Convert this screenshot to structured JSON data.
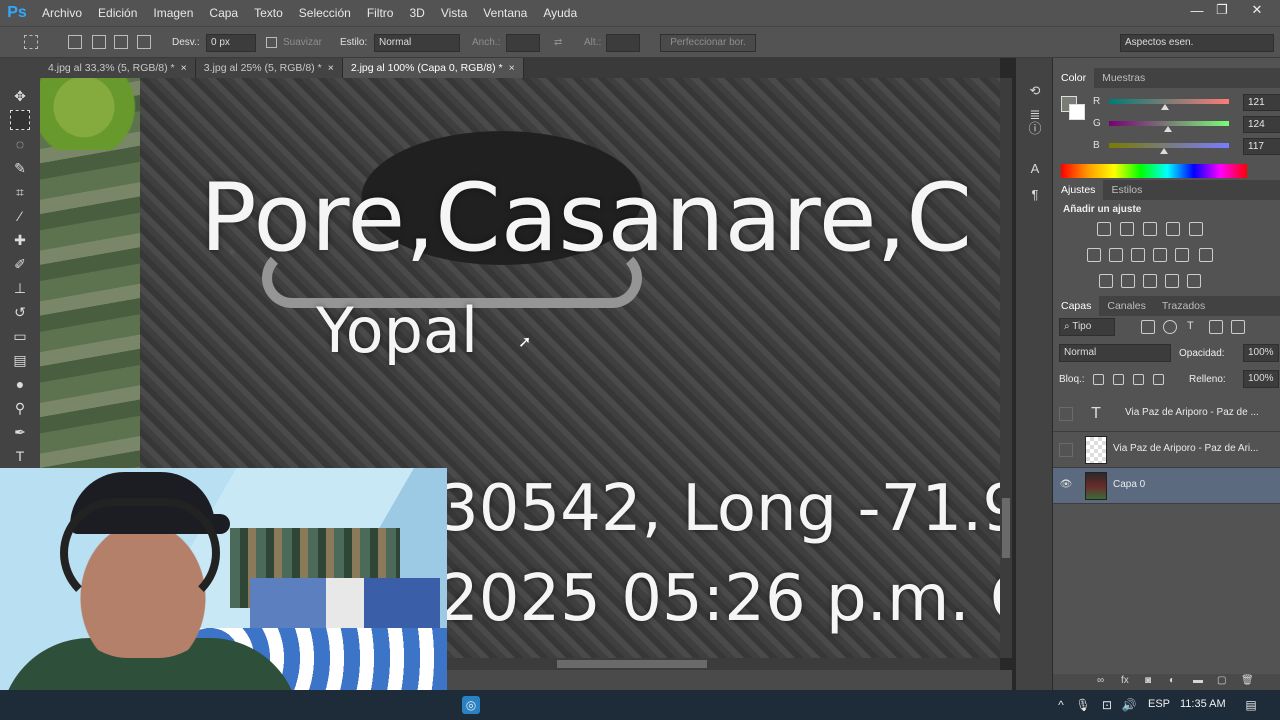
{
  "app": {
    "logo": "Ps"
  },
  "menu": [
    "Archivo",
    "Edición",
    "Imagen",
    "Capa",
    "Texto",
    "Selección",
    "Filtro",
    "3D",
    "Vista",
    "Ventana",
    "Ayuda"
  ],
  "window_controls": {
    "minimize": "—",
    "restore": "❐",
    "close": "✕"
  },
  "options": {
    "feather_label": "Desv.:",
    "feather_value": "0 px",
    "antialias_label": "Suavizar",
    "style_label": "Estilo:",
    "style_value": "Normal",
    "width_label": "Anch.:",
    "height_label": "Alt.:",
    "refine_label": "Perfeccionar bor.",
    "workspace": "Aspectos esen."
  },
  "tabs": [
    {
      "label": "4.jpg al 33,3% (5, RGB/8) *",
      "close": "×"
    },
    {
      "label": "3.jpg al 25% (5, RGB/8) *",
      "close": "×"
    },
    {
      "label": "2.jpg al 100% (Capa 0, RGB/8) *",
      "close": "×"
    }
  ],
  "canvas": {
    "line1": "Pore,Casanare,C",
    "line2": "Yopal",
    "line3": "30542, Long -71.9",
    "line4": "2025 05:26 p.m. C"
  },
  "color_panel": {
    "tabs": [
      "Color",
      "Muestras"
    ],
    "r_label": "R",
    "r_value": "121",
    "g_label": "G",
    "g_value": "124",
    "b_label": "B",
    "b_value": "117",
    "r_level": 0.47,
    "g_level": 0.49,
    "b_level": 0.46,
    "fg_color": "#797c75"
  },
  "adjustments": {
    "tabs": [
      "Ajustes",
      "Estilos"
    ],
    "title": "Añadir un ajuste"
  },
  "layers_panel": {
    "tabs": [
      "Capas",
      "Canales",
      "Trazados"
    ],
    "filter_label": "Tipo",
    "blend_mode": "Normal",
    "opacity_label": "Opacidad:",
    "opacity_value": "100%",
    "lock_label": "Bloq.:",
    "fill_label": "Relleno:",
    "fill_value": "100%",
    "layers": [
      {
        "name": "Via Paz de Ariporo - Paz de ...",
        "kind": "text",
        "glyph": "T"
      },
      {
        "name": "Via Paz de Ariporo - Paz de Ari...",
        "kind": "raster"
      },
      {
        "name": "Capa 0",
        "kind": "image",
        "visible_glyph": "👁"
      }
    ]
  },
  "taskbar": {
    "language": "ESP",
    "time": "11:35 AM",
    "caret": "^"
  }
}
